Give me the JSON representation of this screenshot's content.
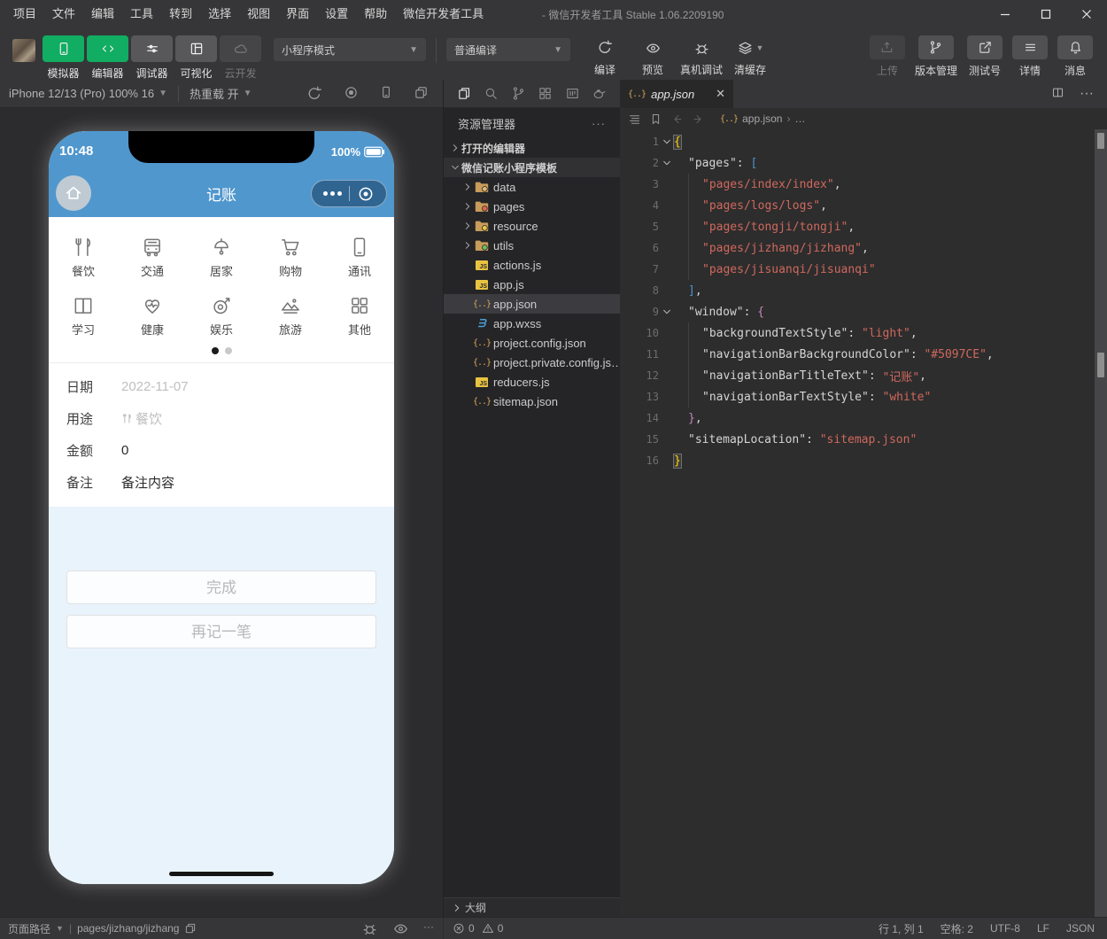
{
  "window": {
    "menus": [
      "项目",
      "文件",
      "编辑",
      "工具",
      "转到",
      "选择",
      "视图",
      "界面",
      "设置",
      "帮助",
      "微信开发者工具"
    ],
    "title": "- 微信开发者工具 Stable 1.06.2209190"
  },
  "toolbar": {
    "mode_buttons": [
      {
        "label": "模拟器",
        "icon": "simulator-icon",
        "state": "active"
      },
      {
        "label": "编辑器",
        "icon": "code-icon",
        "state": "active"
      },
      {
        "label": "调试器",
        "icon": "sliders-icon",
        "state": "normal"
      },
      {
        "label": "可视化",
        "icon": "layout-icon",
        "state": "normal"
      },
      {
        "label": "云开发",
        "icon": "cloud-icon",
        "state": "disabled"
      }
    ],
    "mode_select": "小程序模式",
    "compile_select": "普通编译",
    "compile_actions": [
      {
        "label": "编译",
        "icon": "refresh-icon"
      },
      {
        "label": "预览",
        "icon": "eye-icon"
      },
      {
        "label": "真机调试",
        "icon": "bug-icon"
      },
      {
        "label": "清缓存",
        "icon": "layers-icon",
        "dropdown": true
      }
    ],
    "right_actions": [
      {
        "label": "上传",
        "icon": "upload-icon",
        "state": "disabled"
      },
      {
        "label": "版本管理",
        "icon": "branch-icon",
        "state": "normal"
      },
      {
        "label": "测试号",
        "icon": "external-icon",
        "state": "normal"
      },
      {
        "label": "详情",
        "icon": "list-icon",
        "state": "normal"
      },
      {
        "label": "消息",
        "icon": "bell-icon",
        "state": "normal"
      }
    ],
    "accent_green": "#10ad62"
  },
  "simulator": {
    "device_label": "iPhone 12/13 (Pro) 100% 16",
    "hot_reload_label": "热重载 开",
    "phone": {
      "status": {
        "time": "10:48",
        "battery": "100%"
      },
      "nav": {
        "title": "记账",
        "bg_color": "#5097CE"
      },
      "categories": [
        [
          {
            "label": "餐饮",
            "icon": "food-icon"
          },
          {
            "label": "交通",
            "icon": "transport-icon"
          },
          {
            "label": "居家",
            "icon": "lamp-icon"
          },
          {
            "label": "购物",
            "icon": "cart-icon"
          },
          {
            "label": "通讯",
            "icon": "phone-icon"
          }
        ],
        [
          {
            "label": "学习",
            "icon": "book-icon"
          },
          {
            "label": "健康",
            "icon": "heart-icon"
          },
          {
            "label": "娱乐",
            "icon": "game-icon"
          },
          {
            "label": "旅游",
            "icon": "travel-icon"
          },
          {
            "label": "其他",
            "icon": "grid-icon"
          }
        ]
      ],
      "form": [
        {
          "label": "日期",
          "value": "2022-11-07",
          "muted": true
        },
        {
          "label": "用途",
          "value": "餐饮",
          "muted": true,
          "value_icon": "food-icon"
        },
        {
          "label": "金额",
          "value": "0",
          "muted": false
        },
        {
          "label": "备注",
          "value": "备注内容",
          "muted": false
        }
      ],
      "buttons": [
        "完成",
        "再记一笔"
      ]
    }
  },
  "explorer": {
    "title": "资源管理器",
    "tree": [
      {
        "label": "打开的编辑器",
        "kind": "section",
        "arrow": "right"
      },
      {
        "label": "微信记账小程序模板",
        "kind": "root",
        "arrow": "down"
      },
      {
        "label": "data",
        "kind": "folder",
        "badge": "#dcb67a",
        "arrow": "right"
      },
      {
        "label": "pages",
        "kind": "folder",
        "badge": "#e0674f",
        "arrow": "right"
      },
      {
        "label": "resource",
        "kind": "folder",
        "badge": "#e6c845",
        "arrow": "right"
      },
      {
        "label": "utils",
        "kind": "folder",
        "badge": "#6cbf5e",
        "arrow": "right"
      },
      {
        "label": "actions.js",
        "kind": "js"
      },
      {
        "label": "app.js",
        "kind": "js"
      },
      {
        "label": "app.json",
        "kind": "json",
        "selected": true
      },
      {
        "label": "app.wxss",
        "kind": "wxss"
      },
      {
        "label": "project.config.json",
        "kind": "json"
      },
      {
        "label": "project.private.config.js…",
        "kind": "json"
      },
      {
        "label": "reducers.js",
        "kind": "js"
      },
      {
        "label": "sitemap.json",
        "kind": "json"
      }
    ],
    "outline_label": "大纲",
    "problems": {
      "errors": "0",
      "warnings": "0"
    }
  },
  "editor": {
    "tab": {
      "name": "app.json"
    },
    "breadcrumb": {
      "file": "app.json",
      "more": "…"
    },
    "code": [
      {
        "n": "1",
        "fold": true,
        "indent": 0,
        "tokens": [
          [
            "bhl",
            "{"
          ]
        ]
      },
      {
        "n": "2",
        "fold": true,
        "indent": 1,
        "tokens": [
          [
            "key",
            "\"pages\""
          ],
          [
            "pn",
            ": "
          ],
          [
            "br",
            "["
          ]
        ]
      },
      {
        "n": "3",
        "indent": 2,
        "tokens": [
          [
            "str",
            "\"pages/index/index\""
          ],
          [
            "pn",
            ","
          ]
        ]
      },
      {
        "n": "4",
        "indent": 2,
        "tokens": [
          [
            "str",
            "\"pages/logs/logs\""
          ],
          [
            "pn",
            ","
          ]
        ]
      },
      {
        "n": "5",
        "indent": 2,
        "tokens": [
          [
            "str",
            "\"pages/tongji/tongji\""
          ],
          [
            "pn",
            ","
          ]
        ]
      },
      {
        "n": "6",
        "indent": 2,
        "tokens": [
          [
            "str",
            "\"pages/jizhang/jizhang\""
          ],
          [
            "pn",
            ","
          ]
        ]
      },
      {
        "n": "7",
        "indent": 2,
        "tokens": [
          [
            "str",
            "\"pages/jisuanqi/jisuanqi\""
          ]
        ]
      },
      {
        "n": "8",
        "indent": 1,
        "tokens": [
          [
            "br",
            "]"
          ],
          [
            "pn",
            ","
          ]
        ]
      },
      {
        "n": "9",
        "fold": true,
        "indent": 1,
        "tokens": [
          [
            "key",
            "\"window\""
          ],
          [
            "pn",
            ": "
          ],
          [
            "bc",
            "{"
          ]
        ]
      },
      {
        "n": "10",
        "indent": 2,
        "tokens": [
          [
            "key",
            "\"backgroundTextStyle\""
          ],
          [
            "pn",
            ": "
          ],
          [
            "str",
            "\"light\""
          ],
          [
            "pn",
            ","
          ]
        ]
      },
      {
        "n": "11",
        "indent": 2,
        "tokens": [
          [
            "key",
            "\"navigationBarBackgroundColor\""
          ],
          [
            "pn",
            ": "
          ],
          [
            "str",
            "\"#5097CE\""
          ],
          [
            "pn",
            ","
          ]
        ]
      },
      {
        "n": "12",
        "indent": 2,
        "tokens": [
          [
            "key",
            "\"navigationBarTitleText\""
          ],
          [
            "pn",
            ": "
          ],
          [
            "str",
            "\"记账\""
          ],
          [
            "pn",
            ","
          ]
        ]
      },
      {
        "n": "13",
        "indent": 2,
        "tokens": [
          [
            "key",
            "\"navigationBarTextStyle\""
          ],
          [
            "pn",
            ": "
          ],
          [
            "str",
            "\"white\""
          ]
        ]
      },
      {
        "n": "14",
        "indent": 1,
        "tokens": [
          [
            "bc",
            "}"
          ],
          [
            "pn",
            ","
          ]
        ]
      },
      {
        "n": "15",
        "indent": 1,
        "tokens": [
          [
            "key",
            "\"sitemapLocation\""
          ],
          [
            "pn",
            ": "
          ],
          [
            "str",
            "\"sitemap.json\""
          ]
        ]
      },
      {
        "n": "16",
        "indent": 0,
        "tokens": [
          [
            "bhl",
            "}"
          ]
        ]
      }
    ]
  },
  "statusbar": {
    "page_path_label": "页面路径",
    "page_path": "pages/jizhang/jizhang",
    "right_items": [
      "行 1, 列 1",
      "空格: 2",
      "UTF-8",
      "LF",
      "JSON"
    ]
  }
}
